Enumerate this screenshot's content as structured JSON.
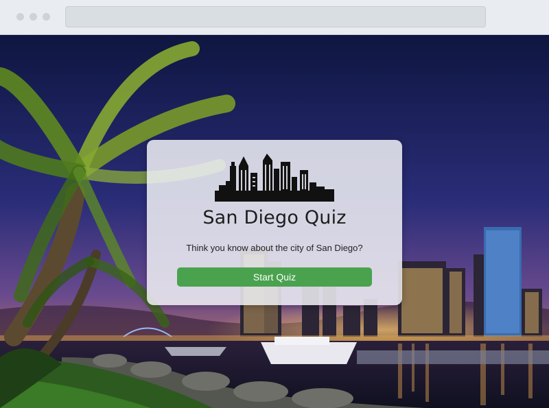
{
  "browser": {
    "address_bar": ""
  },
  "quiz": {
    "logo_icon": "city-skyline-icon",
    "title": "San Diego Quiz",
    "subtitle": "Think you know about the city of San Diego?",
    "start_button_label": "Start Quiz"
  },
  "background": {
    "description_icon": "san-diego-night-skyline-photo",
    "accent_button_color": "#4aa24f"
  }
}
